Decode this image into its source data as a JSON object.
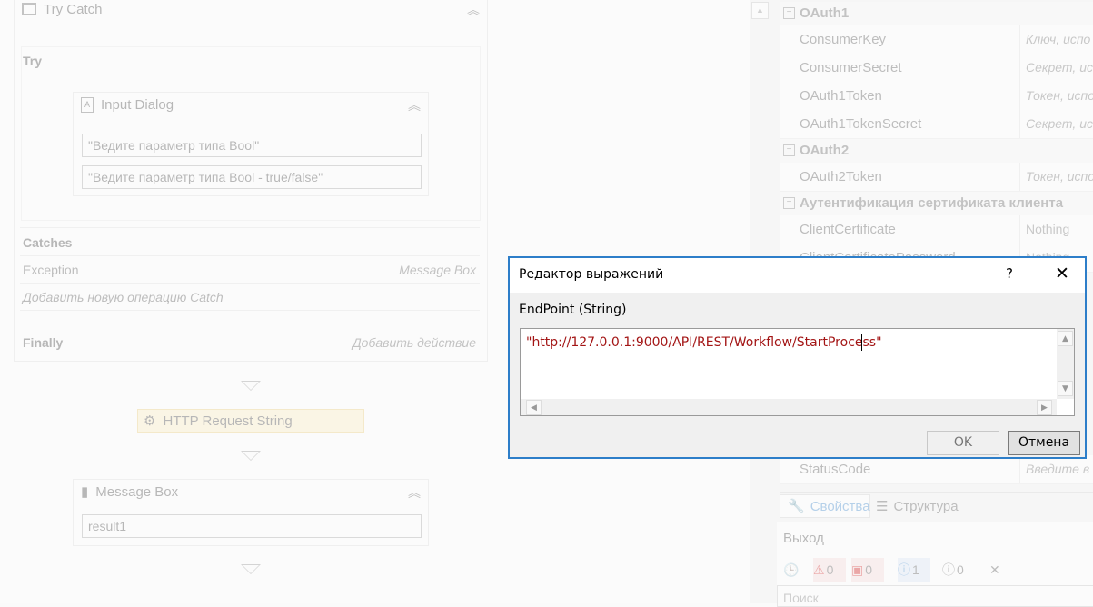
{
  "designer": {
    "try_catch": {
      "title": "Try Catch",
      "try_label": "Try",
      "catches_label": "Catches",
      "finally_label": "Finally",
      "exception_label": "Exception",
      "exception_handler": "Message Box",
      "add_catch": "Добавить новую операцию Catch",
      "add_action": "Добавить действие"
    },
    "input_dialog": {
      "title": "Input Dialog",
      "field1": "\"Ведите параметр типа Bool\"",
      "field2": "\"Ведите параметр типа Bool - true/false\""
    },
    "http_request": {
      "title": "HTTP Request String"
    },
    "message_box": {
      "title": "Message Box",
      "value": "result1"
    }
  },
  "properties": {
    "groups": [
      {
        "name": "OAuth1",
        "rows": [
          {
            "name": "ConsumerKey",
            "value": "Ключ, испо"
          },
          {
            "name": "ConsumerSecret",
            "value": "Секрет, ис"
          },
          {
            "name": "OAuth1Token",
            "value": "Токен, испо"
          },
          {
            "name": "OAuth1TokenSecret",
            "value": "Секрет, ис"
          }
        ]
      },
      {
        "name": "OAuth2",
        "rows": [
          {
            "name": "OAuth2Token",
            "value": "Токен, испо"
          }
        ]
      },
      {
        "name": "Аутентификация сертификата клиента",
        "rows": [
          {
            "name": "ClientCertificate",
            "value": "Nothing"
          },
          {
            "name": "ClientCertificatePassword",
            "value": "Nothing"
          }
        ]
      }
    ],
    "status_row": {
      "name": "StatusCode",
      "value": "Введите в"
    },
    "tabs": {
      "properties": "Свойства",
      "structure": "Структура"
    },
    "output": {
      "title": "Выход",
      "errors": "0",
      "warnings": "0",
      "info": "1",
      "other": "0",
      "search_placeholder": "Поиск"
    }
  },
  "dialog": {
    "title": "Редактор выражений",
    "help": "?",
    "close": "✕",
    "field_label": "EndPoint (String)",
    "expression": "\"http://127.0.0.1:9000/API/REST/Workflow/StartProcess\"",
    "ok": "OK",
    "cancel": "Отмена"
  },
  "colors": {
    "dialog_border": "#2d7ec9",
    "expression_text": "#a31515",
    "http_activity_bg": "#fdebbb"
  }
}
